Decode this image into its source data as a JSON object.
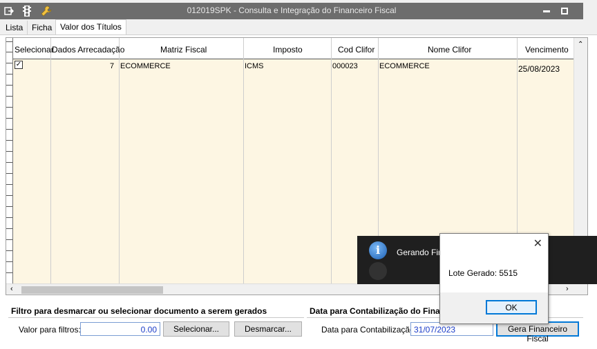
{
  "window": {
    "title": "012019SPK - Consulta e Integração do Financeiro Fiscal",
    "icons": [
      "export-icon",
      "traffic-light-icon",
      "wrench-icon"
    ],
    "controls": [
      "minimize-icon",
      "restore-icon"
    ]
  },
  "tabs": [
    {
      "label": "Lista"
    },
    {
      "label": "Ficha"
    },
    {
      "label": "Valor dos Títulos",
      "active": true
    }
  ],
  "grid": {
    "columns": [
      "Selecionar",
      "Dados Arrecadação",
      "Matriz Fiscal",
      "Imposto",
      "Cod Clifor",
      "Nome Clifor",
      "Vencimento"
    ],
    "rows": [
      {
        "selecionar": true,
        "dados_arrecadacao": "7",
        "matriz_fiscal": "ECOMMERCE",
        "imposto": "ICMS",
        "cod_clifor": "000023",
        "nome_clifor": "ECOMMERCE",
        "vencimento": "25/08/2023"
      }
    ]
  },
  "filter_section": {
    "title": "Filtro para desmarcar ou selecionar documento a serem gerados",
    "value_label": "Valor para filtros:",
    "value": "0.00",
    "select_button": "Selecionar...",
    "deselect_button": "Desmarcar..."
  },
  "date_section": {
    "title": "Data para Contabilização do Fina",
    "date_label": "Data para Contabilização:",
    "date_value": "31/07/2023",
    "generate_button": "Gera Financeiro Fiscal"
  },
  "toast": {
    "message": "Gerando Fina"
  },
  "dialog": {
    "message": "Lote Gerado: 5515",
    "ok_label": "OK"
  }
}
